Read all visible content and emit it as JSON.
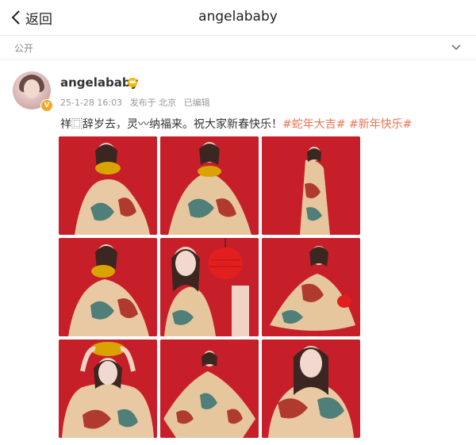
{
  "header": {
    "back_label": "返回",
    "title": "angelababy"
  },
  "visibility": {
    "label": "公开"
  },
  "post": {
    "author": "angelababy",
    "date": "25-1-28 16:03",
    "source": "发布于 北京",
    "edited": "已编辑",
    "text": "祥⿴辞岁去，灵⁠〰纳福来。祝大家新春快乐！",
    "hashtags": [
      "#蛇年大吉#",
      "#新年快乐#"
    ],
    "photos": [
      {
        "pose": "sitting, holding gold ingot"
      },
      {
        "pose": "sitting, holding gold ingot"
      },
      {
        "pose": "standing, full length"
      },
      {
        "pose": "sitting, holding gold ingot"
      },
      {
        "pose": "close-up, holding red lantern"
      },
      {
        "pose": "sitting on floor"
      },
      {
        "pose": "ingot on head"
      },
      {
        "pose": "arms spread, full length"
      },
      {
        "pose": "close-up portrait"
      }
    ]
  },
  "colors": {
    "accent_tag": "#eb7350",
    "photo_background": "#c8202b",
    "verified_badge": "#f5a623"
  }
}
